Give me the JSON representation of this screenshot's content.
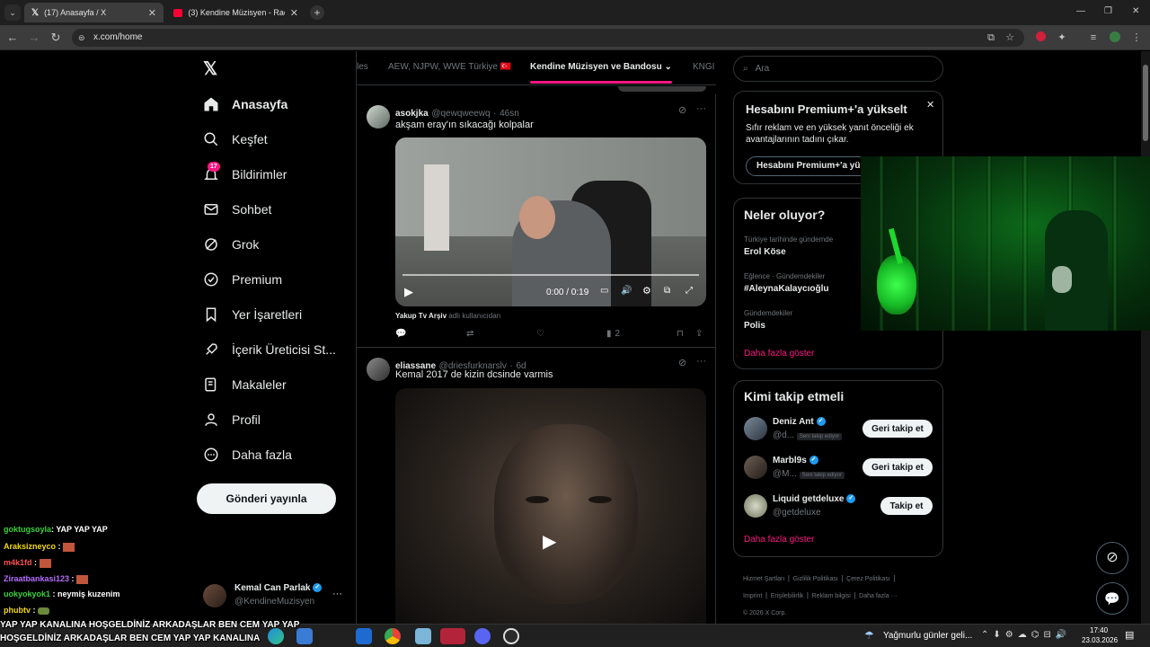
{
  "browser": {
    "tabs": [
      {
        "title": "(17) Anasayfa / X",
        "active": true
      },
      {
        "title": "(3) Kendine Müzisyen - Raedm",
        "active": false
      }
    ],
    "url": "x.com/home",
    "window_controls": [
      "—",
      "❐",
      "✕"
    ]
  },
  "x_logo": "𝕏",
  "nav": {
    "items": [
      {
        "label": "Anasayfa",
        "icon": "home-icon",
        "active": true
      },
      {
        "label": "Keşfet",
        "icon": "search-icon"
      },
      {
        "label": "Bildirimler",
        "icon": "bell-icon",
        "badge": "17"
      },
      {
        "label": "Sohbet",
        "icon": "mail-icon"
      },
      {
        "label": "Grok",
        "icon": "grok-icon"
      },
      {
        "label": "Premium",
        "icon": "premium-icon"
      },
      {
        "label": "Yer İşaretleri",
        "icon": "bookmark-icon"
      },
      {
        "label": "İçerik Üreticisi St...",
        "icon": "rocket-icon"
      },
      {
        "label": "Makaleler",
        "icon": "article-icon"
      },
      {
        "label": "Profil",
        "icon": "profile-icon"
      },
      {
        "label": "Daha fazla",
        "icon": "more-circle-icon"
      }
    ],
    "post_button": "Gönderi yayınla",
    "account": {
      "name": "Kemal Can Parlak",
      "handle": "@KendineMuzisyen",
      "more": "···"
    }
  },
  "topic_tabs": [
    "les",
    "AEW, NJPW, WWE Türkiye 🇹🇷",
    "Kendine Müzisyen ve Bandosu",
    "KNGI"
  ],
  "tweets": [
    {
      "name": "asokjka",
      "handle": "@qewqweewq",
      "time": "46sn",
      "text": "akşam eray'ın sıkacağı kolpalar",
      "video_time": "0:00 / 0:19",
      "attribution_name": "Yakup Tv Arşiv",
      "attribution_rest": "adlı kullanıcıdan",
      "views": "2"
    },
    {
      "name": "eliassane",
      "handle": "@driesfurknarslv",
      "time": "6d",
      "text": "Kemal 2017 de kizin dcsinde varmis"
    }
  ],
  "search": {
    "placeholder": "Ara"
  },
  "premium_card": {
    "title": "Hesabını Premium+'a yükselt",
    "body": "Sıfır reklam ve en yüksek yanıt önceliği ek avantajlarının tadını çıkar.",
    "button": "Hesabını Premium+'a yü"
  },
  "trends": {
    "title": "Neler oluyor?",
    "items": [
      {
        "context": "Türkiye tarihinde gündemde",
        "name": "Erol Köse"
      },
      {
        "context": "Eğlence · Gündemdekiler",
        "name": "#AleynaKalaycıoğlu"
      },
      {
        "context": "Gündemdekiler",
        "name": "Polis"
      }
    ],
    "more": "Daha fazla göster"
  },
  "who_to_follow": {
    "title": "Kimi takip etmeli",
    "users": [
      {
        "name": "Deniz Ant",
        "handle": "@d...",
        "follows_you": "Seni takip ediyor",
        "button": "Geri takip et"
      },
      {
        "name": "Marbl9s",
        "handle": "@M...",
        "follows_you": "Seni takip ediyor",
        "button": "Geri takip et"
      },
      {
        "name": "Liquid getdeluxe",
        "handle": "@getdeluxe",
        "follows_you": "",
        "button": "Takip et"
      }
    ],
    "more": "Daha fazla göster"
  },
  "footer": {
    "links": [
      "Hizmet Şartları",
      "Gizlilik Politikası",
      "Çerez Politikası",
      "Imprint",
      "Erişilebilirlik",
      "Reklam bilgisi",
      "Daha fazla ···"
    ],
    "copyright": "© 2026 X Corp."
  },
  "chat": [
    {
      "user": "goktugsoyla",
      "msg": ": YAP YAP YAP",
      "color": "#3ad13a"
    },
    {
      "user": "Araksizneyco",
      "msg": " :",
      "color": "#f5d90a"
    },
    {
      "user": "m4k1fd",
      "msg": " :",
      "color": "#ff4f4f"
    },
    {
      "user": "Ziraatbankasi123",
      "msg": " :",
      "color": "#b56cff"
    },
    {
      "user": "uokyokyok1",
      "msg": " : neymiş kuzenim",
      "color": "#3ad13a"
    },
    {
      "user": "phubtv",
      "msg": " :",
      "color": "#f5d90a"
    }
  ],
  "ticker": {
    "line1": "YAP YAP KANALINA HOŞGELDİNİZ ARKADAŞLAR BEN CEM YAP YAP",
    "line2": "HOŞGELDİNİZ ARKADAŞLAR BEN CEM YAP YAP KANALINA"
  },
  "taskbar": {
    "weather": "Yağmurlu günler geli...",
    "time": "17:40",
    "date": "23.03.2026"
  }
}
